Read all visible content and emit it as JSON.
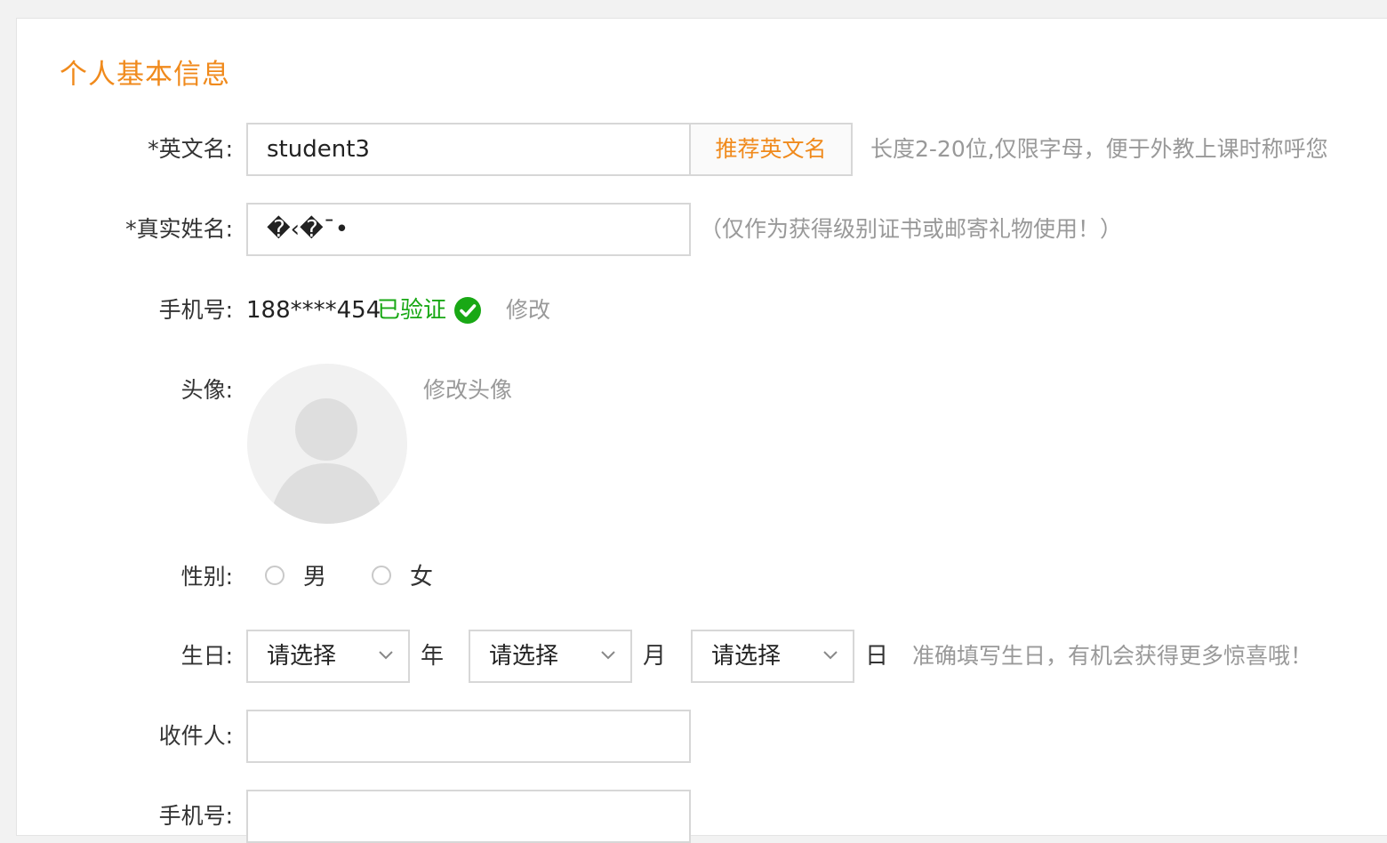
{
  "section": {
    "title": "个人基本信息"
  },
  "english_name": {
    "label": "*英文名:",
    "value": "student3",
    "suggest_label": "推荐英文名",
    "hint": "长度2-20位,仅限字母，便于外教上课时称呼您"
  },
  "real_name": {
    "label": "*真实姓名:",
    "value": "�‹�¯•",
    "hint": "（仅作为获得级别证书或邮寄礼物使用！）"
  },
  "phone": {
    "label": "手机号:",
    "value": "188****454",
    "status": "已验证",
    "edit_label": "修改"
  },
  "avatar": {
    "label": "头像:",
    "edit_label": "修改头像"
  },
  "gender": {
    "label": "性别:",
    "options": [
      "男",
      "女"
    ]
  },
  "birthday": {
    "label": "生日:",
    "year_placeholder": "请选择",
    "year_unit": "年",
    "month_placeholder": "请选择",
    "month_unit": "月",
    "day_placeholder": "请选择",
    "day_unit": "日",
    "hint": "准确填写生日，有机会获得更多惊喜哦！"
  },
  "recipient": {
    "label": "收件人:",
    "value": ""
  },
  "recipient_phone": {
    "label": "手机号:",
    "value": ""
  },
  "colors": {
    "accent": "#f08a1c",
    "verified": "#19a815",
    "hint": "#999999",
    "border": "#d7d7d7"
  },
  "icons": {
    "verified": "check-circle-icon",
    "select": "chevron-down-icon",
    "avatar": "user-silhouette-icon"
  }
}
